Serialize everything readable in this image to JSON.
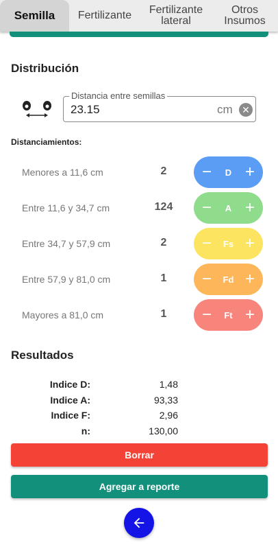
{
  "tabs": [
    {
      "label": "Semilla",
      "active": true
    },
    {
      "label": "Fertilizante",
      "active": false
    },
    {
      "label_line1": "Fertilizante",
      "label_line2": "lateral",
      "active": false
    },
    {
      "label_line1": "Otros",
      "label_line2": "Insumos",
      "active": false
    }
  ],
  "distribution": {
    "title": "Distribución",
    "distance_field": {
      "label": "Distancia entre semillas",
      "value": "23.15",
      "unit": "cm"
    }
  },
  "spacings": {
    "title": "Distanciamientos:",
    "rows": [
      {
        "label": "Menores a 11,6 cm",
        "count": "2",
        "code": "D",
        "color": "#5b9cf5"
      },
      {
        "label": "Entre 11,6 y 34,7 cm",
        "count": "124",
        "code": "A",
        "color": "#8fdc8c"
      },
      {
        "label": "Entre 34,7 y 57,9 cm",
        "count": "2",
        "code": "Fs",
        "color": "#fde460"
      },
      {
        "label": "Entre 57,9 y 81,0 cm",
        "count": "1",
        "code": "Fd",
        "color": "#fdb65a"
      },
      {
        "label": "Mayores a 81,0 cm",
        "count": "1",
        "code": "Ft",
        "color": "#f7857c"
      }
    ]
  },
  "results": {
    "title": "Resultados",
    "rows": [
      {
        "label": "Indice D:",
        "value": "1,48"
      },
      {
        "label": "Indice A:",
        "value": "93,33"
      },
      {
        "label": "Indice F:",
        "value": "2,96"
      },
      {
        "label": "n:",
        "value": "130,00"
      }
    ]
  },
  "actions": {
    "clear_label": "Borrar",
    "add_label": "Agregar a reporte"
  },
  "colors": {
    "teal": "#13907c",
    "red": "#f44336",
    "fab_blue": "#1414e6"
  },
  "icons": {
    "seed": "seed-distance-icon",
    "clear": "clear-circle-icon",
    "back": "arrow-left-icon"
  }
}
